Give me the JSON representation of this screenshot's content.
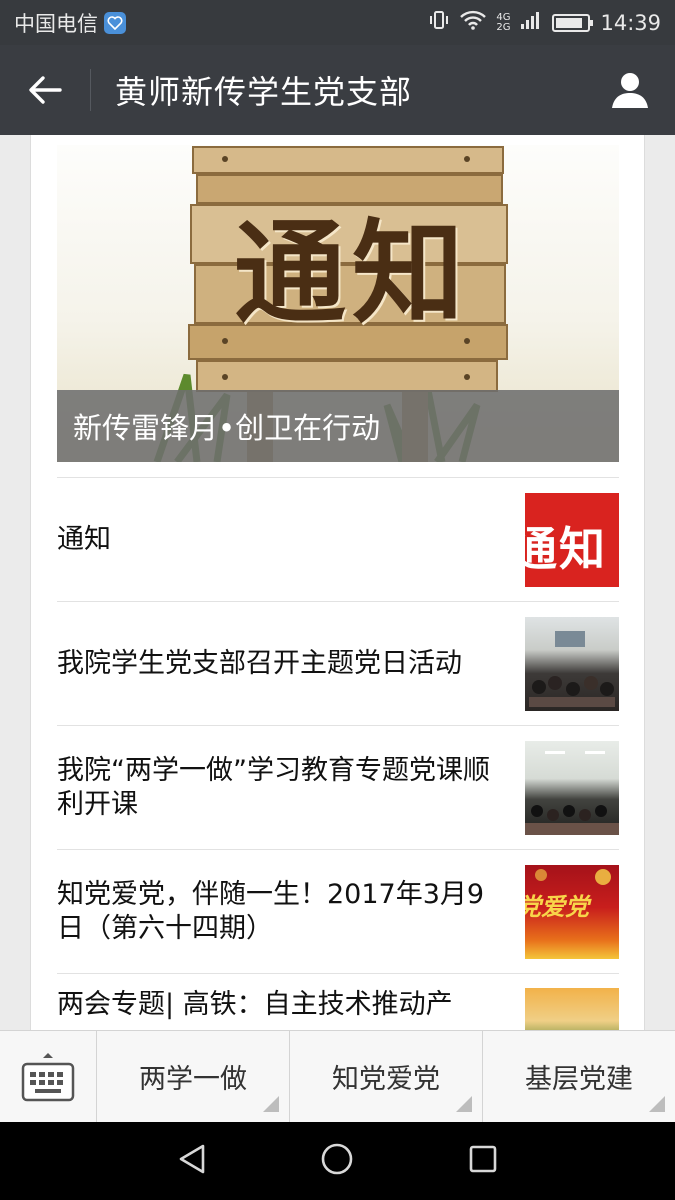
{
  "status": {
    "carrier": "中国电信",
    "network": "4G",
    "network_sub": "2G",
    "time": "14:39"
  },
  "nav": {
    "title": "黄师新传学生党支部"
  },
  "hero": {
    "sign_text": "通知",
    "caption": "新传雷锋月•创卫在行动"
  },
  "articles": [
    {
      "title": "通知",
      "thumb": "notice-thumbnail",
      "thumb_text": "通知"
    },
    {
      "title": "我院学生党支部召开主题党日活动",
      "thumb": "meeting-photo-thumbnail"
    },
    {
      "title": "我院“两学一做”学习教育专题党课顺利开课",
      "thumb": "lecture-photo-thumbnail"
    },
    {
      "title": "知党爱党，伴随一生！2017年3月9日（第六十四期）",
      "thumb": "party-banner-thumbnail",
      "thumb_text": "党爱党"
    },
    {
      "title": "两会专题| 高铁：自主技术推动产",
      "thumb": "landscape-thumbnail"
    }
  ],
  "menu": {
    "items": [
      "两学一做",
      "知党爱党",
      "基层党建"
    ]
  },
  "colors": {
    "nav_bg": "#3a3d42",
    "status_bg": "#373a3e",
    "notice_red": "#d9231f"
  }
}
